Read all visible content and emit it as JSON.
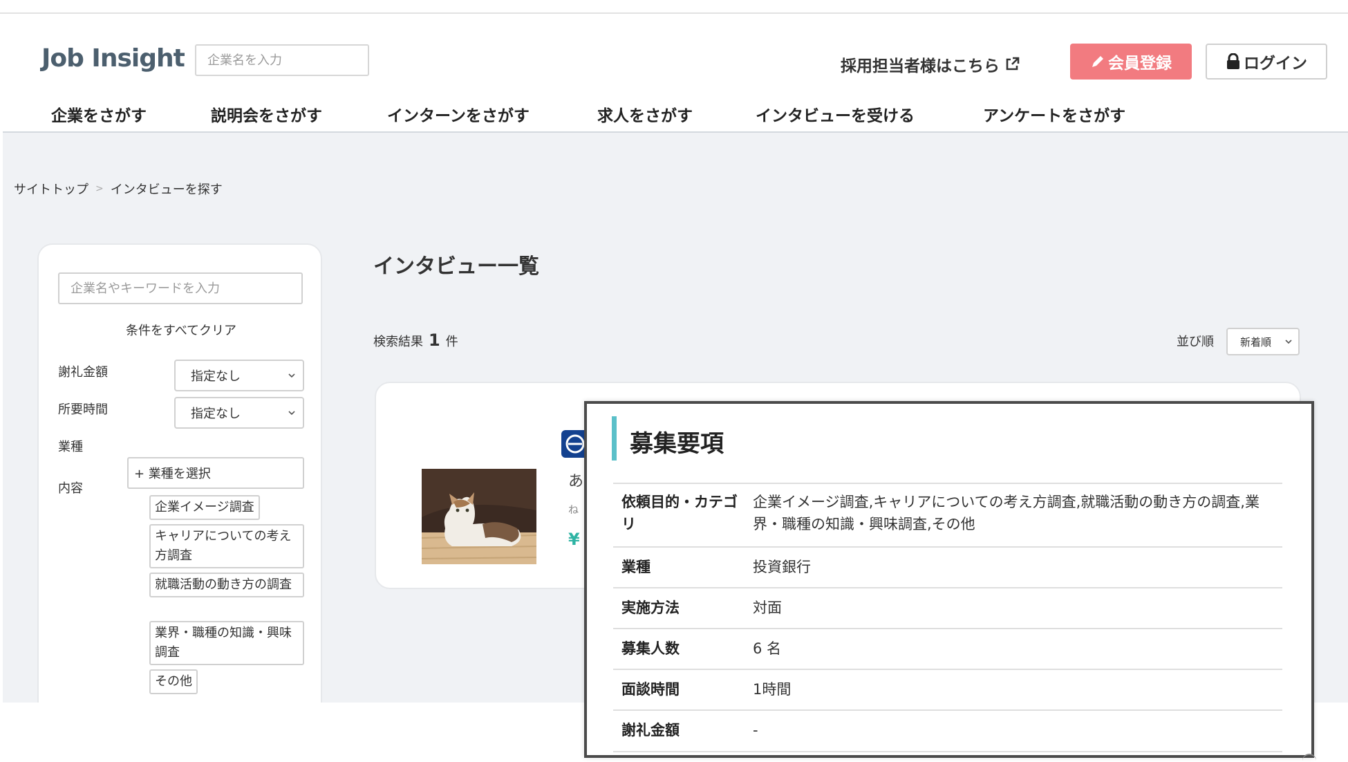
{
  "header": {
    "logo": "Job Insight",
    "search_placeholder": "企業名を入力",
    "recruiter_link": "採用担当者様はこちら",
    "register": "会員登録",
    "login": "ログイン"
  },
  "nav": [
    "企業をさがす",
    "説明会をさがす",
    "インターンをさがす",
    "求人をさがす",
    "インタビューを受ける",
    "アンケートをさがす"
  ],
  "breadcrumb": {
    "top": "サイトトップ",
    "sep": ">",
    "current": "インタビューを探す"
  },
  "sidebar": {
    "search_placeholder": "企業名やキーワードを入力",
    "clear": "条件をすべてクリア",
    "reward_label": "謝礼金額",
    "reward_value": "指定なし",
    "time_label": "所要時間",
    "time_value": "指定なし",
    "industry_label": "業種",
    "industry_button": "+ 業種を選択",
    "content_label": "内容",
    "tags": [
      "企業イメージ調査",
      "キャリアについての考え方調査",
      "就職活動の動き方の調査",
      "業界・職種の知識・興味調査",
      "その他"
    ]
  },
  "main": {
    "title": "インタビュー一覧",
    "result_prefix": "検索結果",
    "result_count": "1",
    "result_suffix": "件",
    "sort_label": "並び順",
    "sort_value": "新着順"
  },
  "card": {
    "frag_title": "あ",
    "frag_sub": "ね",
    "frag_yen": "¥"
  },
  "popup": {
    "title": "募集要項",
    "rows": [
      {
        "key": "依頼目的・カテゴリ",
        "value": "企業イメージ調査,キャリアについての考え方調査,就職活動の動き方の調査,業界・職種の知識・興味調査,その他"
      },
      {
        "key": "業種",
        "value": "投資銀行"
      },
      {
        "key": "実施方法",
        "value": "対面"
      },
      {
        "key": "募集人数",
        "value": "6 名"
      },
      {
        "key": "面談時間",
        "value": "1時間"
      },
      {
        "key": "謝礼金額",
        "value": "-"
      }
    ]
  },
  "colors": {
    "register_bg": "#f27b80",
    "accent_teal": "#5bc0c9",
    "content_bg": "#f0f2f5",
    "logo_text": "#4c5f6e"
  }
}
